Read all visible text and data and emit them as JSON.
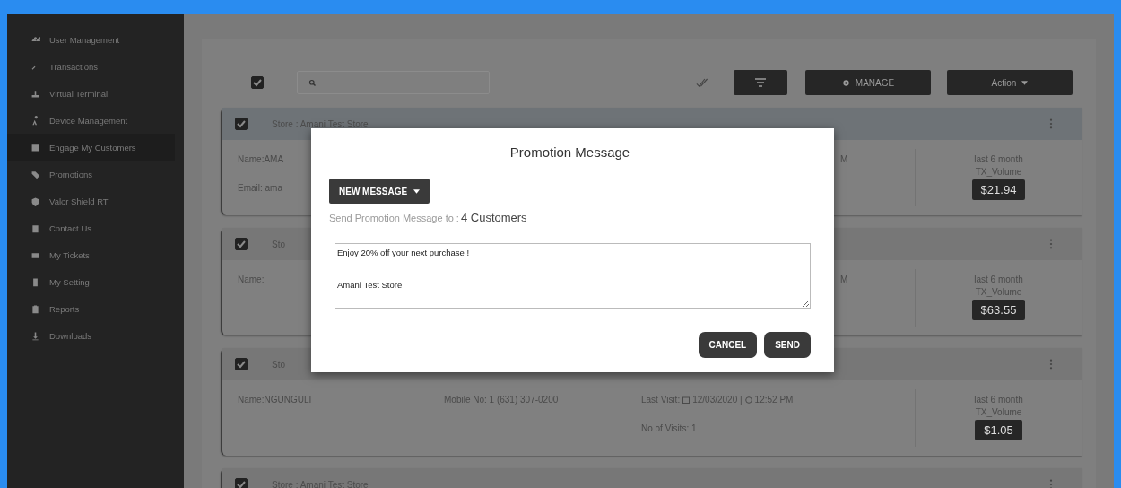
{
  "sidebar": {
    "items": [
      {
        "label": "User Management",
        "selected": false
      },
      {
        "label": "Transactions",
        "selected": false
      },
      {
        "label": "Virtual Terminal",
        "selected": false
      },
      {
        "label": "Device Management",
        "selected": false
      },
      {
        "label": "Engage My Customers",
        "selected": true
      },
      {
        "label": "Promotions",
        "selected": false
      },
      {
        "label": "Valor Shield RT",
        "selected": false
      },
      {
        "label": "Contact Us",
        "selected": false
      },
      {
        "label": "My Tickets",
        "selected": false
      },
      {
        "label": "My Setting",
        "selected": false
      },
      {
        "label": "Reports",
        "selected": false
      },
      {
        "label": "Downloads",
        "selected": false
      }
    ]
  },
  "toolbar": {
    "select_all_checked": true,
    "manage": "MANAGE",
    "action": "Action"
  },
  "cards": [
    {
      "checked": true,
      "store": "Store : Amani Test Store",
      "name": "Name:AMA",
      "email": "Email: ama",
      "visit_tail": "M",
      "volume_label": "last 6 month",
      "volume_sublabel": "TX_Volume",
      "volume": "$21.94"
    },
    {
      "checked": true,
      "store": "Sto",
      "name": "Name:",
      "visit_tail": "M",
      "volume_label": "last 6 month",
      "volume_sublabel": "TX_Volume",
      "volume": "$63.55"
    },
    {
      "checked": true,
      "store": "Sto",
      "name": "Name:NGUNGULI",
      "mobile": "Mobile No: 1 (631) 307-0200",
      "visit_label": "Last Visit:",
      "visit_date": "12/03/2020 |",
      "visit_time": "12:52 PM",
      "visits": "No of Visits: 1",
      "volume_label": "last 6 month",
      "volume_sublabel": "TX_Volume",
      "volume": "$1.05"
    },
    {
      "checked": true,
      "store": "Store : Amani Test Store"
    }
  ],
  "modal": {
    "title": "Promotion Message",
    "new_message": "NEW MESSAGE",
    "send_to": "Send Promotion Message to :",
    "count": "4 Customers",
    "message": "Enjoy 20% off your next purchase !\n\n\nAmani Test Store",
    "cancel": "CANCEL",
    "send": "SEND"
  }
}
